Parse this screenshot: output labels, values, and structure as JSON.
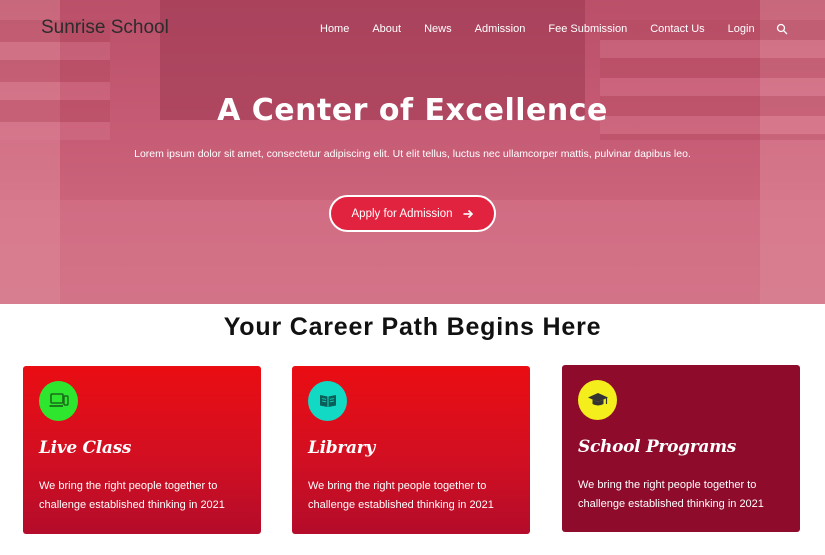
{
  "header": {
    "brand": "Sunrise School",
    "nav": [
      "Home",
      "About",
      "News",
      "Admission",
      "Fee Submission",
      "Contact Us",
      "Login"
    ],
    "search_icon": "search-icon"
  },
  "hero": {
    "title": "A Center of Excellence",
    "subtitle": "Lorem ipsum dolor sit amet, consectetur adipiscing elit. Ut elit tellus, luctus nec ullamcorper mattis, pulvinar dapibus leo.",
    "cta_label": "Apply for Admission",
    "cta_icon": "arrow-right-icon"
  },
  "section": {
    "title": "Your Career Path Begins Here"
  },
  "cards": [
    {
      "title": "Live Class",
      "text": "We bring the right people together to challenge established thinking in 2021",
      "icon": "laptop-icon",
      "icon_color": "#2ee62e"
    },
    {
      "title": "Library",
      "text": "We bring the right people together to challenge established thinking in 2021",
      "icon": "book-icon",
      "icon_color": "#11d9c4"
    },
    {
      "title": "School Programs",
      "text": "We bring the right people together to challenge established thinking in 2021",
      "icon": "graduation-cap-icon",
      "icon_color": "#f4ef1c"
    }
  ],
  "colors": {
    "hero_overlay": "#de4e76",
    "cta_bg": "#e2233f",
    "card_red": "#d20f22",
    "card_dark": "#8e0b2b"
  }
}
